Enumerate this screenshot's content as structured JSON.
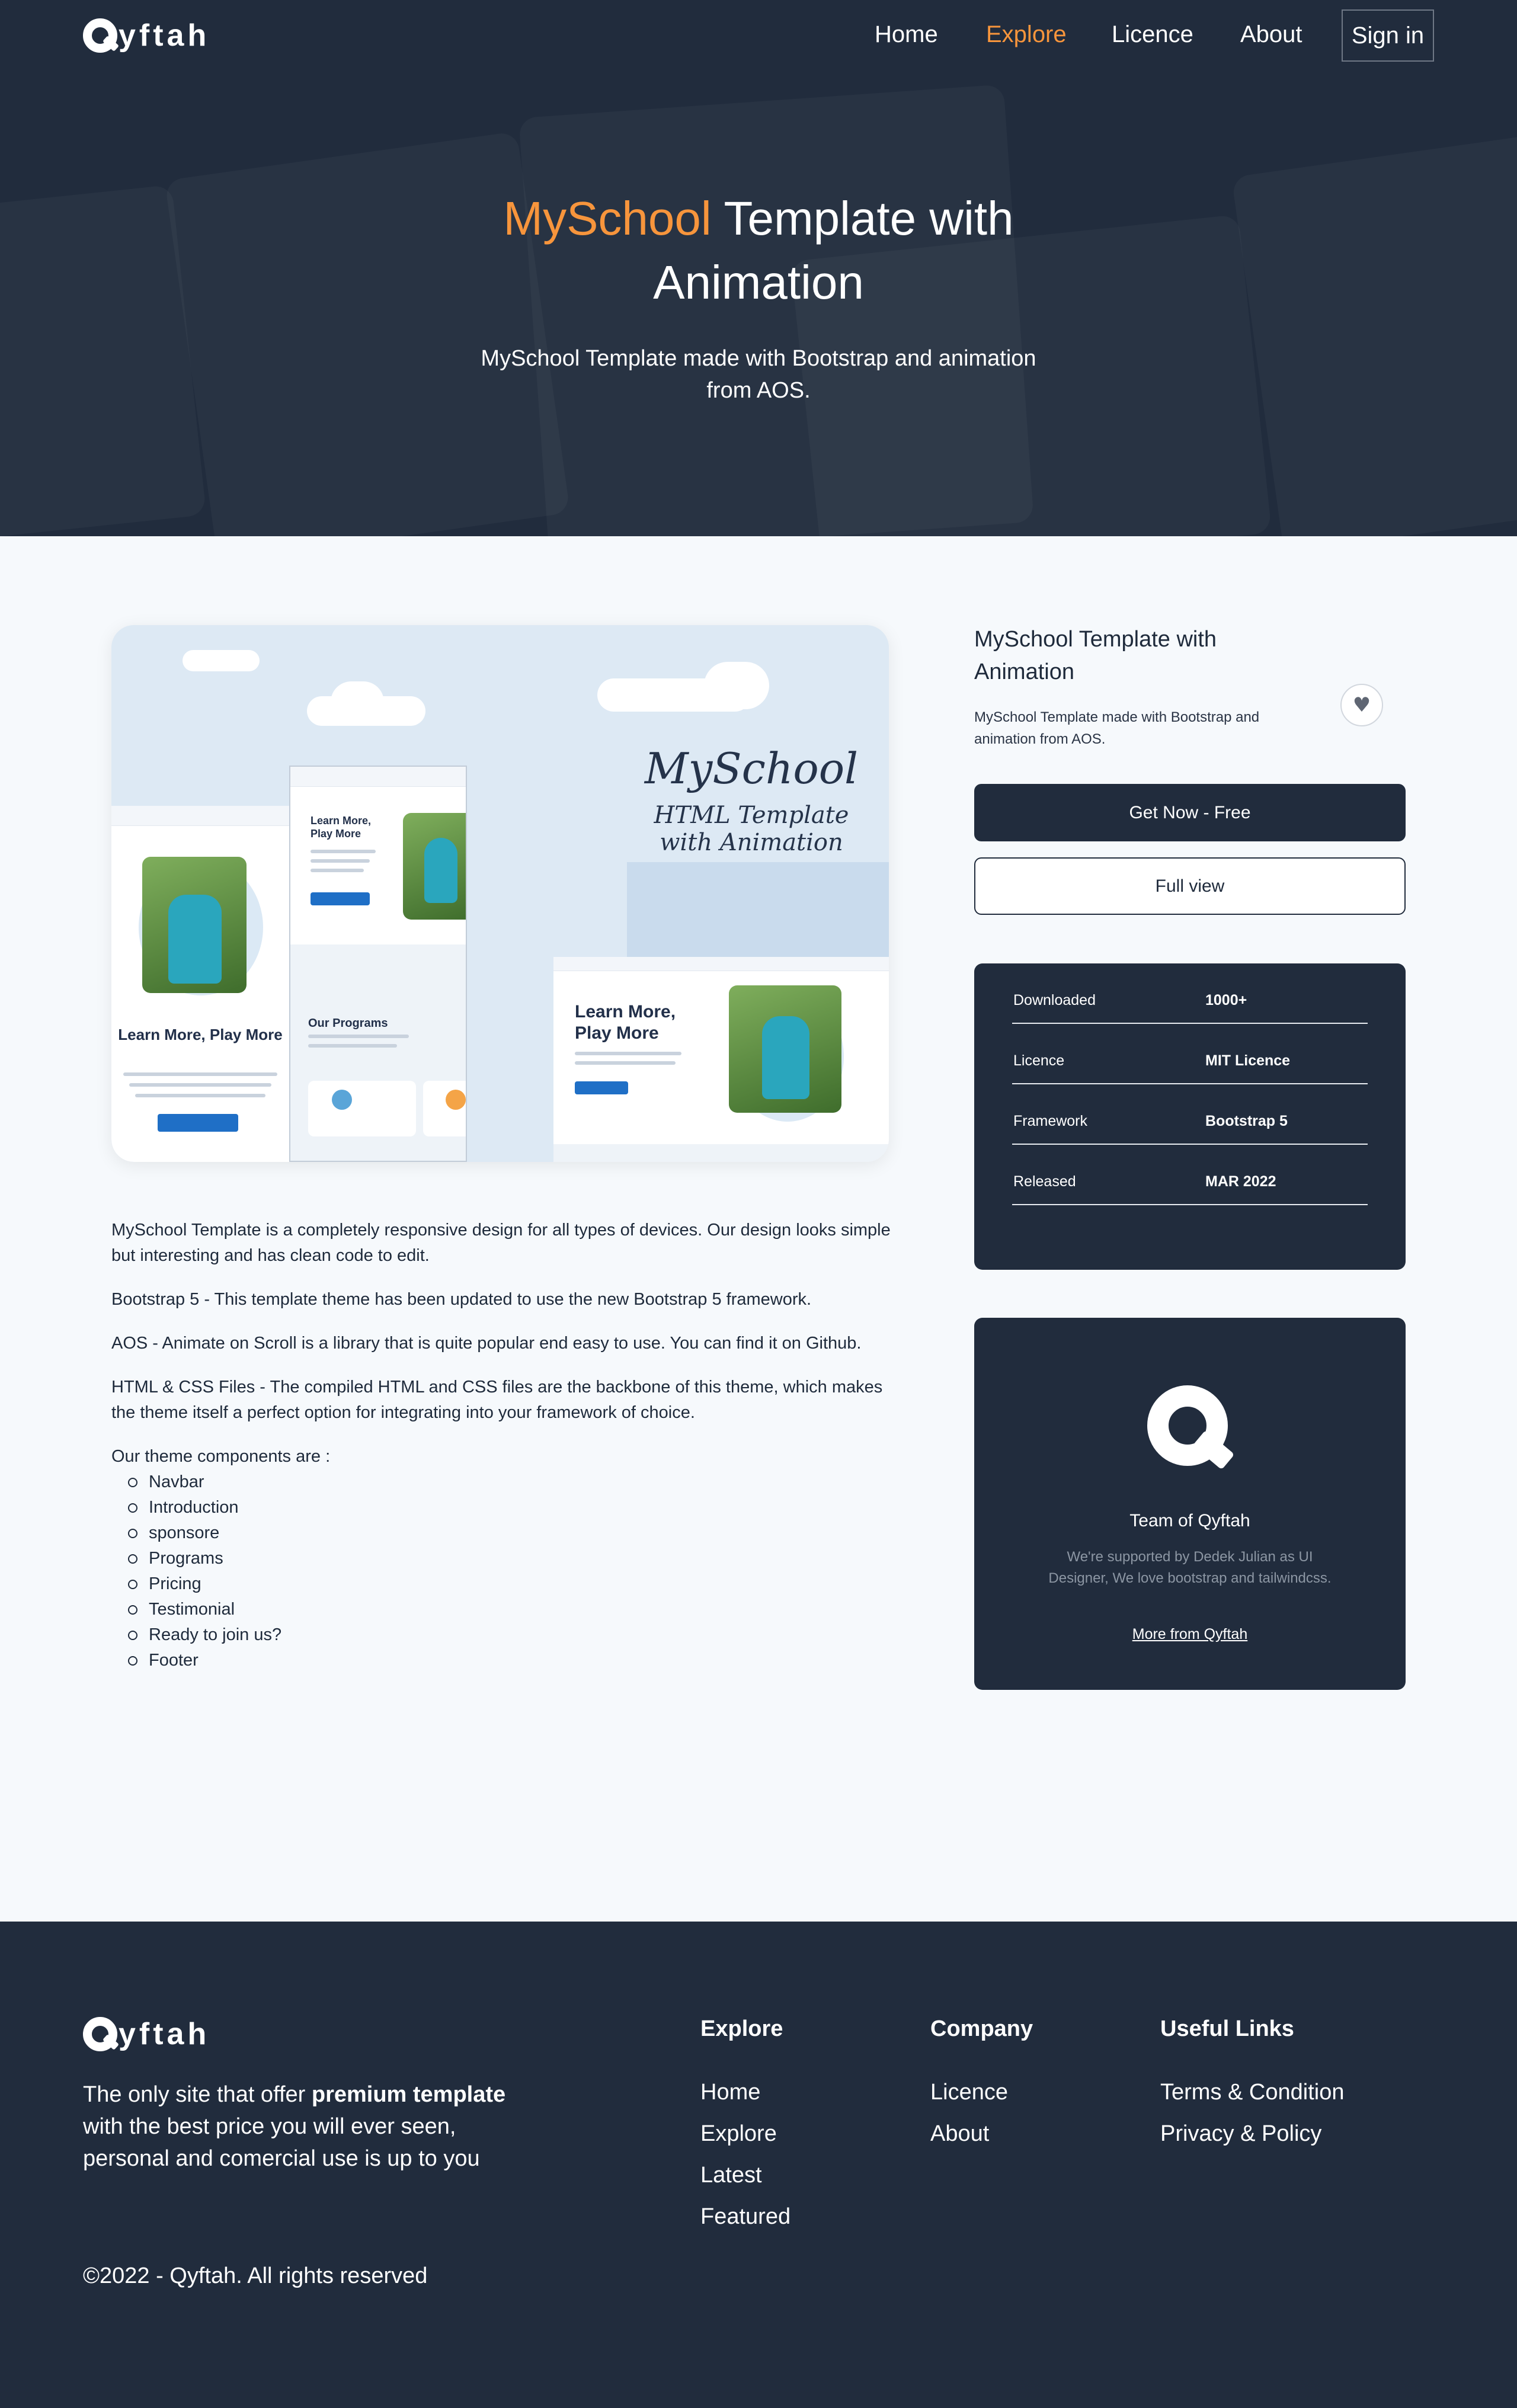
{
  "nav": {
    "logo_text": "yftah",
    "links": [
      "Home",
      "Explore",
      "Licence",
      "About"
    ],
    "signin": "Sign in"
  },
  "hero": {
    "title_accent": "MySchool",
    "title_rest": " Template with",
    "title_line2": "Animation",
    "subtitle": "MySchool Template made with Bootstrap and animation from AOS."
  },
  "preview": {
    "brand_script": "MySchool",
    "brand_sub": "HTML Template with Animation",
    "mock_heading": "Learn More, Play More",
    "mock_section": "Our Programs"
  },
  "description": {
    "paragraphs": [
      "MySchool Template is a completely responsive design for all types of devices. Our design looks simple but interesting and has clean code to edit.",
      "Bootstrap 5 - This template theme has been updated to use the new Bootstrap 5 framework.",
      "AOS - Animate on Scroll is a library that is quite popular end easy to use. You can find it on Github.",
      "HTML & CSS Files - The compiled HTML and CSS files are the backbone of this theme, which makes the theme itself a perfect option for integrating into your framework of choice."
    ],
    "components_title": "Our theme components are :",
    "components": [
      "Navbar",
      "Introduction",
      "sponsore",
      "Programs",
      "Pricing",
      "Testimonial",
      "Ready to join us?",
      "Footer"
    ]
  },
  "sidebar": {
    "title": "MySchool Template with Animation",
    "subtitle": "MySchool Template made with Bootstrap and animation from AOS.",
    "get_button": "Get Now - Free",
    "full_button": "Full view",
    "info": [
      {
        "key": "Downloaded",
        "value": "1000+"
      },
      {
        "key": "Licence",
        "value": "MIT Licence"
      },
      {
        "key": "Framework",
        "value": "Bootstrap 5"
      },
      {
        "key": "Released",
        "value": "MAR 2022"
      }
    ],
    "team": {
      "name": "Team of Qyftah",
      "text": "We're supported by Dedek Julian as UI Designer, We love bootstrap and tailwindcss.",
      "link": "More from Qyftah"
    }
  },
  "footer": {
    "logo_text": "yftah",
    "about_pre": "The only site that offer ",
    "about_bold": "premium template",
    "about_post": " with the best price you will ever seen, personal and comercial use is up to you",
    "copyright": "©2022 - Qyftah. All rights reserved",
    "columns": [
      {
        "title": "Explore",
        "items": [
          "Home",
          "Explore",
          "Latest",
          "Featured"
        ]
      },
      {
        "title": "Company",
        "items": [
          "Licence",
          "About"
        ]
      },
      {
        "title": "Useful Links",
        "items": [
          "Terms & Condition",
          "Privacy & Policy"
        ]
      }
    ]
  },
  "colors": {
    "navy": "#212c3d",
    "accent": "#f7953c",
    "page_bg": "#f6f9fc"
  }
}
